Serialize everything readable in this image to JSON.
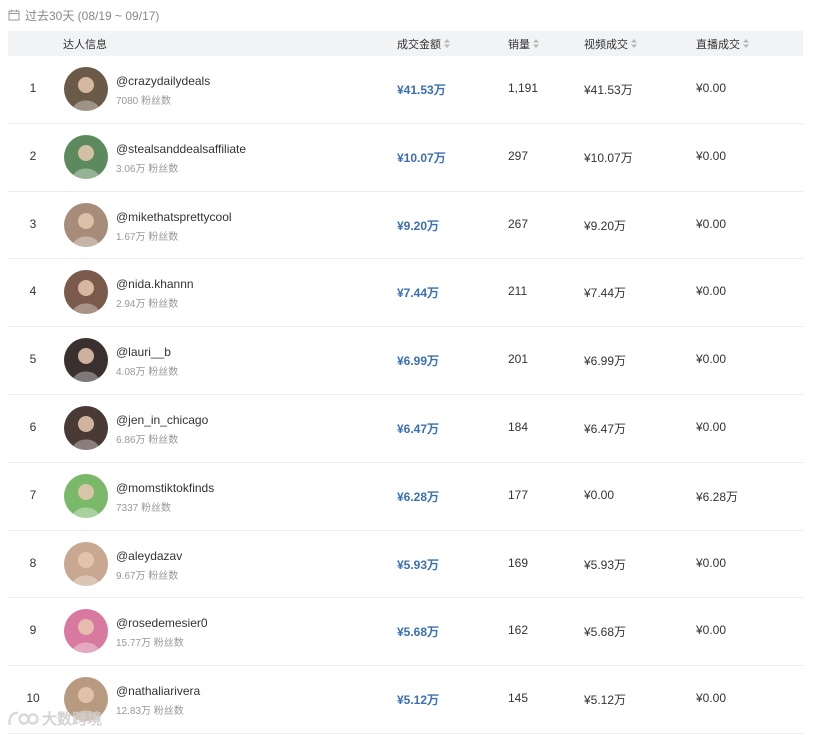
{
  "date_range": "过去30天 (08/19 ~ 09/17)",
  "columns": {
    "influencer": "达人信息",
    "gmv": "成交金额",
    "sales": "销量",
    "video_gmv": "视频成交",
    "live_gmv": "直播成交"
  },
  "rows": [
    {
      "rank": "1",
      "handle": "@crazydailydeals",
      "fans": "7080 粉丝数",
      "gmv": "¥41.53万",
      "sales": "1,191",
      "video": "¥41.53万",
      "live": "¥0.00",
      "avatar_color": "#6b5a48"
    },
    {
      "rank": "2",
      "handle": "@stealsanddealsaffiliate",
      "fans": "3.06万 粉丝数",
      "gmv": "¥10.07万",
      "sales": "297",
      "video": "¥10.07万",
      "live": "¥0.00",
      "avatar_color": "#5c8a5e"
    },
    {
      "rank": "3",
      "handle": "@mikethatsprettycool",
      "fans": "1.67万 粉丝数",
      "gmv": "¥9.20万",
      "sales": "267",
      "video": "¥9.20万",
      "live": "¥0.00",
      "avatar_color": "#a88c7a"
    },
    {
      "rank": "4",
      "handle": "@nida.khannn",
      "fans": "2.94万 粉丝数",
      "gmv": "¥7.44万",
      "sales": "211",
      "video": "¥7.44万",
      "live": "¥0.00",
      "avatar_color": "#7a5a4a"
    },
    {
      "rank": "5",
      "handle": "@lauri__b",
      "fans": "4.08万 粉丝数",
      "gmv": "¥6.99万",
      "sales": "201",
      "video": "¥6.99万",
      "live": "¥0.00",
      "avatar_color": "#3a3030"
    },
    {
      "rank": "6",
      "handle": "@jen_in_chicago",
      "fans": "6.86万 粉丝数",
      "gmv": "¥6.47万",
      "sales": "184",
      "video": "¥6.47万",
      "live": "¥0.00",
      "avatar_color": "#4a3a36"
    },
    {
      "rank": "7",
      "handle": "@momstiktokfinds",
      "fans": "7337 粉丝数",
      "gmv": "¥6.28万",
      "sales": "177",
      "video": "¥0.00",
      "live": "¥6.28万",
      "avatar_color": "#7ab86a"
    },
    {
      "rank": "8",
      "handle": "@aleydazav",
      "fans": "9.67万 粉丝数",
      "gmv": "¥5.93万",
      "sales": "169",
      "video": "¥5.93万",
      "live": "¥0.00",
      "avatar_color": "#c8a890"
    },
    {
      "rank": "9",
      "handle": "@rosedemesier0",
      "fans": "15.77万 粉丝数",
      "gmv": "¥5.68万",
      "sales": "162",
      "video": "¥5.68万",
      "live": "¥0.00",
      "avatar_color": "#d87aa0"
    },
    {
      "rank": "10",
      "handle": "@nathaliarivera",
      "fans": "12.83万 粉丝数",
      "gmv": "¥5.12万",
      "sales": "145",
      "video": "¥5.12万",
      "live": "¥0.00",
      "avatar_color": "#b89a80"
    }
  ],
  "watermark": "大数跨境",
  "icons": {
    "calendar": "calendar-icon",
    "sort": "sort-icon"
  },
  "colors": {
    "accent": "#3a6fb5",
    "header_bg": "#f2f3f5",
    "muted": "#999999"
  }
}
